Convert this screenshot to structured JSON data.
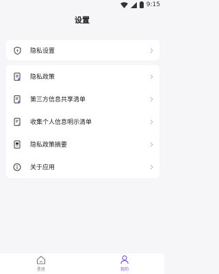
{
  "status_bar": {
    "time": "9:15",
    "icons": [
      "wifi-icon",
      "signal-icon",
      "battery-icon"
    ]
  },
  "header": {
    "title": "设置"
  },
  "privacy_card": {
    "label": "隐私设置",
    "icon": "shield-icon"
  },
  "menu": {
    "items": [
      {
        "label": "隐私政策",
        "icon": "document-icon"
      },
      {
        "label": "第三方信息共享清单",
        "icon": "document-list-icon"
      },
      {
        "label": "收集个人信息明示清单",
        "icon": "document-edit-icon"
      },
      {
        "label": "隐私政策摘要",
        "icon": "document-summary-icon"
      },
      {
        "label": "关于应用",
        "icon": "info-icon"
      }
    ]
  },
  "bottom_nav": {
    "items": [
      {
        "label": "星座",
        "icon": "home-icon",
        "active": false
      },
      {
        "label": "我的",
        "icon": "user-icon",
        "active": true
      }
    ]
  },
  "colors": {
    "accent": "#7b5cd6",
    "background": "#f6f6f8",
    "card": "#ffffff"
  }
}
